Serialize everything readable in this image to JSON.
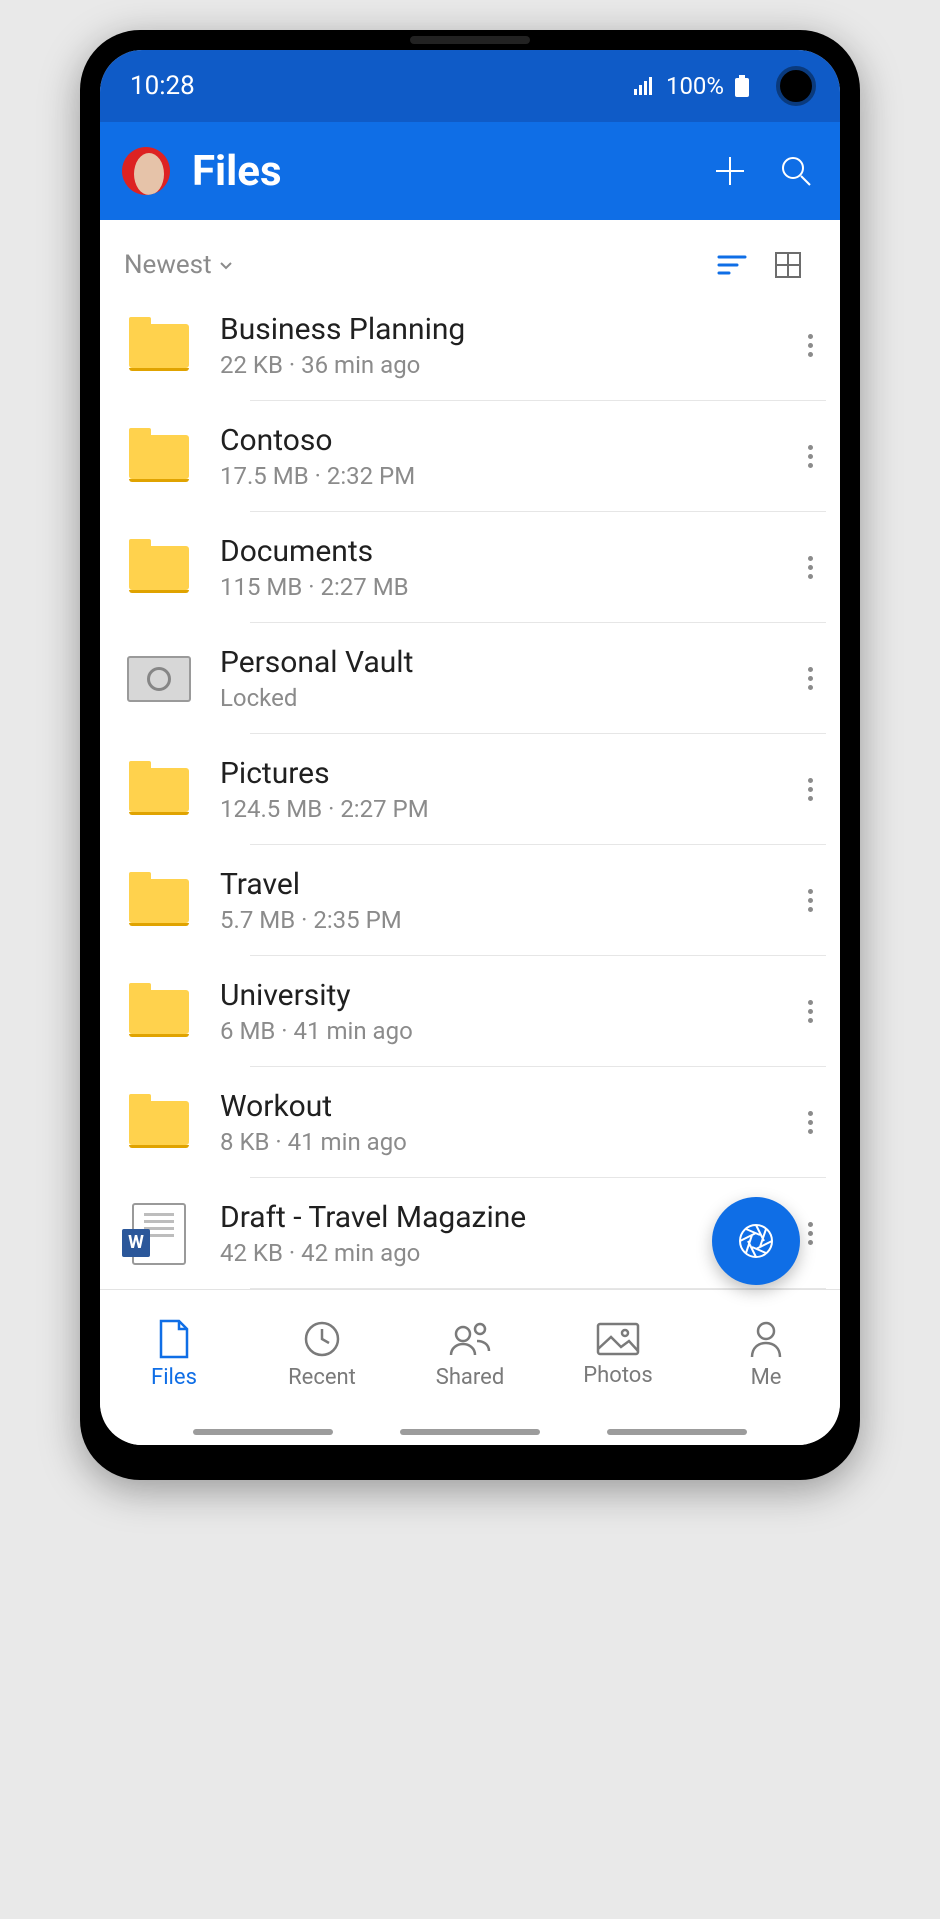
{
  "status": {
    "time": "10:28",
    "battery": "100%"
  },
  "appbar": {
    "title": "Files"
  },
  "sort": {
    "label": "Newest"
  },
  "files": [
    {
      "name": "Business Planning",
      "sub": "22 KB · 36 min ago",
      "icon": "folder"
    },
    {
      "name": "Contoso",
      "sub": "17.5 MB · 2:32 PM",
      "icon": "folder"
    },
    {
      "name": "Documents",
      "sub": "115 MB · 2:27 MB",
      "icon": "folder"
    },
    {
      "name": "Personal Vault",
      "sub": "Locked",
      "icon": "vault"
    },
    {
      "name": "Pictures",
      "sub": "124.5 MB · 2:27 PM",
      "icon": "folder"
    },
    {
      "name": "Travel",
      "sub": "5.7 MB · 2:35 PM",
      "icon": "folder"
    },
    {
      "name": "University",
      "sub": "6 MB · 41 min ago",
      "icon": "folder"
    },
    {
      "name": "Workout",
      "sub": "8 KB · 41 min ago",
      "icon": "folder"
    },
    {
      "name": "Draft - Travel Magazine",
      "sub": "42 KB · 42 min ago",
      "icon": "word"
    }
  ],
  "nav": {
    "files": "Files",
    "recent": "Recent",
    "shared": "Shared",
    "photos": "Photos",
    "me": "Me"
  }
}
